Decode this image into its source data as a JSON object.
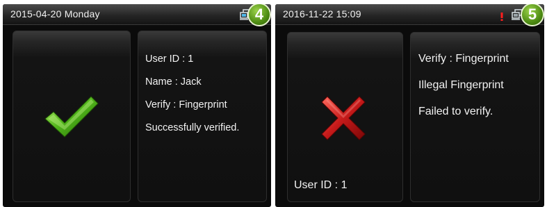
{
  "screens": [
    {
      "datetime": "2015-04-20  Monday",
      "badge": "4",
      "icons": [
        "network-icon"
      ],
      "result": "success",
      "result_icon": "checkmark-icon",
      "info": {
        "user_id": "User ID : 1",
        "name": "Name : Jack",
        "verify": "Verify : Fingerprint",
        "status": "Successfully verified."
      }
    },
    {
      "datetime": "2016-11-22 15:09",
      "badge": "5",
      "icons": [
        "alert-icon",
        "network-icon"
      ],
      "result": "failure",
      "result_icon": "cross-icon",
      "user_id": "User ID : 1",
      "info": {
        "verify": "Verify : Fingerprint",
        "message": "Illegal Fingerprint",
        "status": "Failed to verify."
      }
    }
  ],
  "colors": {
    "success": "#4fb21a",
    "failure": "#c61a1a",
    "alert": "#ff1e1e",
    "badge": "#5a9a18"
  }
}
